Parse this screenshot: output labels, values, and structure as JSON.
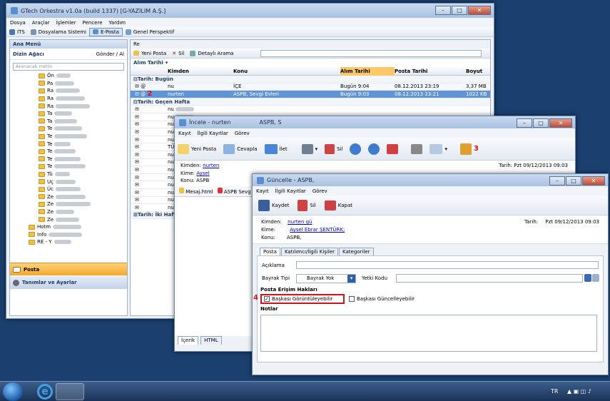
{
  "main_window": {
    "title": "GTech Orkestra v1.0a (build 1337) [G-YAZILIM A.Ş.]",
    "menu": [
      "Dosya",
      "Araçlar",
      "İşlemler",
      "Pencere",
      "Yardım"
    ],
    "perspectives": [
      "İTS",
      "Dosyalama Sistemi",
      "E-Posta",
      "Genel Perspektif"
    ],
    "left": {
      "header": "Ana Menü",
      "tree_title": "Dizin Ağacı",
      "send_recv": "Gönder / Al",
      "search_placeholder": "Aranacak metin",
      "folders": [
        "Ön",
        "Pa",
        "Ra",
        "Ra",
        "Ra",
        "Ta",
        "Ta",
        "Te",
        "Te",
        "Te",
        "Te",
        "Te",
        "Te",
        "Tü",
        "Uç",
        "Üc",
        "Ze",
        "Ze",
        "Ze",
        "Ze",
        "Hotm",
        "Info",
        "RE - Y"
      ],
      "nav_posta": "Posta",
      "nav_tanimlar": "Tanımlar ve Ayarlar"
    },
    "mail_toolbar": {
      "new": "Yeni Posta",
      "delete": "Sil",
      "search": "Detaylı Arama",
      "path": "Re"
    },
    "grid": {
      "sort": "Alım Tarihi",
      "columns": [
        "Kimden",
        "Konu",
        "Alım Tarihi",
        "Posta Tarihi",
        "Boyut"
      ],
      "group1": "Tarih: Bugün",
      "group2": "Tarih: Geçen Hafta",
      "group3": "Tarih: İki Hafta",
      "rows": [
        {
          "from": "nu",
          "subject": "İÇE",
          "recv": "Bugün 9:04",
          "date": "08.12.2013 23:19",
          "size": "3,37 MB"
        },
        {
          "from": "nurten",
          "subject": "ASPB, Sevgi Evleri",
          "recv": "Bugün 9:03",
          "date": "08.12.2013 23:21",
          "size": "1022 KB"
        }
      ],
      "other_rows": [
        "nu",
        "nu",
        "nu",
        "nu",
        "nu",
        "TÜ",
        "nu",
        "nu",
        "nu",
        "nu",
        "nu",
        "nu",
        "nu",
        "nu"
      ]
    }
  },
  "incele": {
    "title": "İncele - nurten",
    "subject_short": "ASPB, S",
    "menu": [
      "Kayıt",
      "İlgili Kayıtlar",
      "Görev"
    ],
    "toolbar": [
      "Yeni Posta",
      "Cevapla",
      "İlet",
      "Sil"
    ],
    "kimden_label": "Kimden:",
    "kimden": "nurten",
    "kime_label": "Kime:",
    "kime": "Aysel",
    "konu_label": "Konu:",
    "konu": "ASPB",
    "tarih_label": "Tarih:",
    "tarih": "Pzt 09/12/2013 09:03",
    "attachments": [
      "Mesaj.html",
      "ASPB Sevg"
    ],
    "bottom_tabs": [
      "İçerik",
      "HTML"
    ]
  },
  "guncelle": {
    "title": "Güncelle - ASPB,",
    "menu": [
      "Kayıt",
      "İlgili Kayıtlar",
      "Görev"
    ],
    "toolbar": {
      "save": "Kaydet",
      "delete": "Sil",
      "close": "Kapat"
    },
    "kimden_label": "Kimden:",
    "kimden": "nurten gü",
    "kime_label": "Kime:",
    "kime": "Aysel Ebrar ŞENTÜRK;",
    "konu_label": "Konu:",
    "konu": "ASPB,",
    "tarih_label": "Tarih:",
    "tarih": "Pzt 09/12/2013 09:03",
    "tabs": [
      "Posta",
      "Katılımcı/İlgili Kişiler",
      "Kategoriler"
    ],
    "aciklama": "Açıklama",
    "bayrak_tipi": "Bayrak Tipi",
    "bayrak_value": "Bayrak Yok",
    "yetki": "Yetki Kodu",
    "erisim": "Posta Erişim Hakları",
    "check1": "Başkası Görüntüleyebilir",
    "check2": "Başkası Güncelleyebilir",
    "notlar": "Notlar"
  },
  "markers": [
    "2",
    "3",
    "4"
  ],
  "taskbar": {
    "lang": "TR"
  }
}
